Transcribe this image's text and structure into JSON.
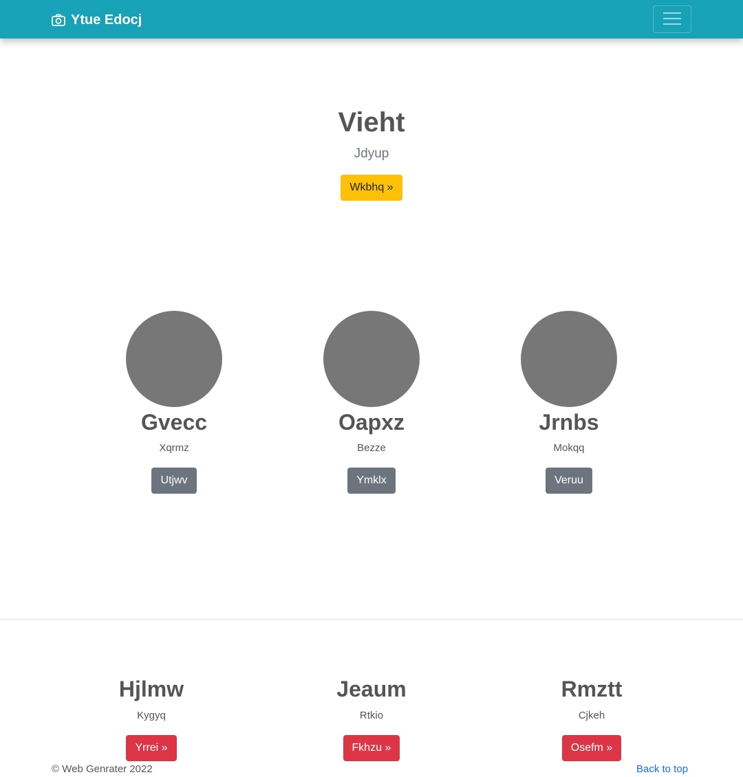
{
  "navbar": {
    "brand": "Ytue Edocj",
    "brand_icon": "camera-icon",
    "toggler_icon": "hamburger-menu-icon",
    "color": "#17a2b8"
  },
  "hero": {
    "title": "Vieht",
    "subtitle": "Jdyup",
    "button": "Wkbhq »"
  },
  "members": [
    {
      "name": "Gvecc",
      "subtitle": "Xqrmz",
      "button": "Utjwv"
    },
    {
      "name": "Oapxz",
      "subtitle": "Bezze",
      "button": "Ymklx"
    },
    {
      "name": "Jrnbs",
      "subtitle": "Mokqq",
      "button": "Veruu"
    }
  ],
  "features": [
    {
      "title": "Hjlmw",
      "subtitle": "Kygyq",
      "button": "Yrrei »"
    },
    {
      "title": "Jeaum",
      "subtitle": "Rtkio",
      "button": "Fkhzu »"
    },
    {
      "title": "Rmztt",
      "subtitle": "Cjkeh",
      "button": "Osefm »"
    }
  ],
  "footer": {
    "copyright": "© Web Genrater 2022",
    "back_to_top": "Back to top"
  },
  "colors": {
    "warning": "#ffc107",
    "secondary": "#6c757d",
    "danger": "#dc3545",
    "link": "#0d6efd",
    "avatar": "#777777"
  }
}
